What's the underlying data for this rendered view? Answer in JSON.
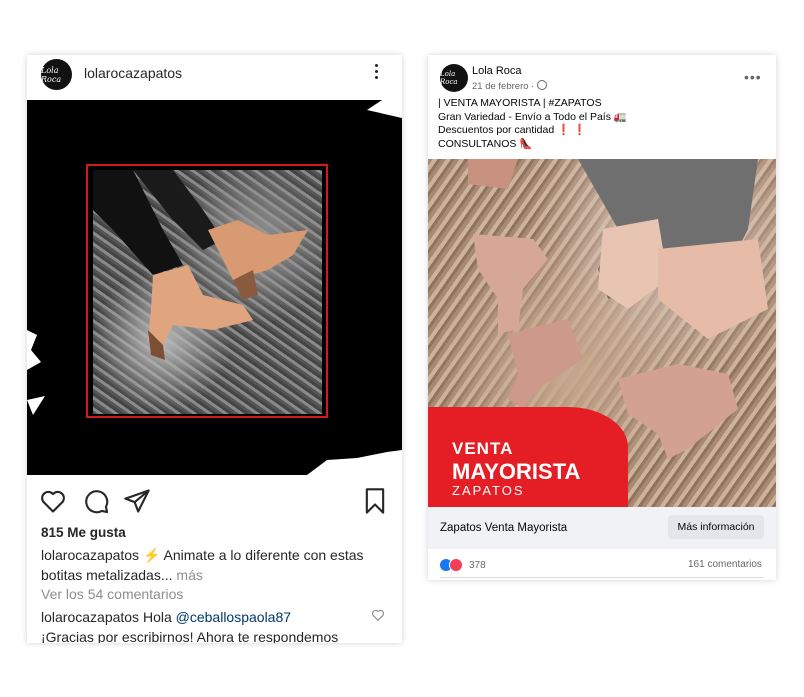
{
  "instagram": {
    "username": "lolarocazapatos",
    "avatar_text": "Lola Roca",
    "likes": "815 Me gusta",
    "caption_user": "lolarocazapatos",
    "caption_text": "⚡ Animate a lo diferente con estas botitas metalizadas...",
    "caption_more": "más",
    "view_comments": "Ver los 54 comentarios",
    "comment_user": "lolarocazapatos",
    "comment_text": "Hola",
    "comment_mention": "@ceballospaola87",
    "comment_reply": "¡Gracias por escribirnos! Ahora te respondemos",
    "icons": [
      "heart-icon",
      "comment-icon",
      "share-icon",
      "bookmark-icon",
      "more-icon"
    ]
  },
  "facebook": {
    "page_name": "Lola Roca",
    "avatar_text": "Lola Roca",
    "date": "21 de febrero ·",
    "post_lines": [
      "| VENTA MAYORISTA | #ZAPATOS",
      "Gran Variedad - Envío a Todo el País 🚛",
      "Descuentos por cantidad ❗ ❗",
      "CONSULTANOS 👠"
    ],
    "promo_line1": "VENTA",
    "promo_line2": "MAYORISTA",
    "promo_line3": "ZAPATOS",
    "cta_title": "Zapatos Venta Mayorista",
    "cta_button": "Más información",
    "reactions": "378",
    "comments": "161 comentarios",
    "colors": {
      "accent_red": "#e51d24",
      "like_blue": "#1877f2",
      "love_red": "#f33e58"
    }
  }
}
